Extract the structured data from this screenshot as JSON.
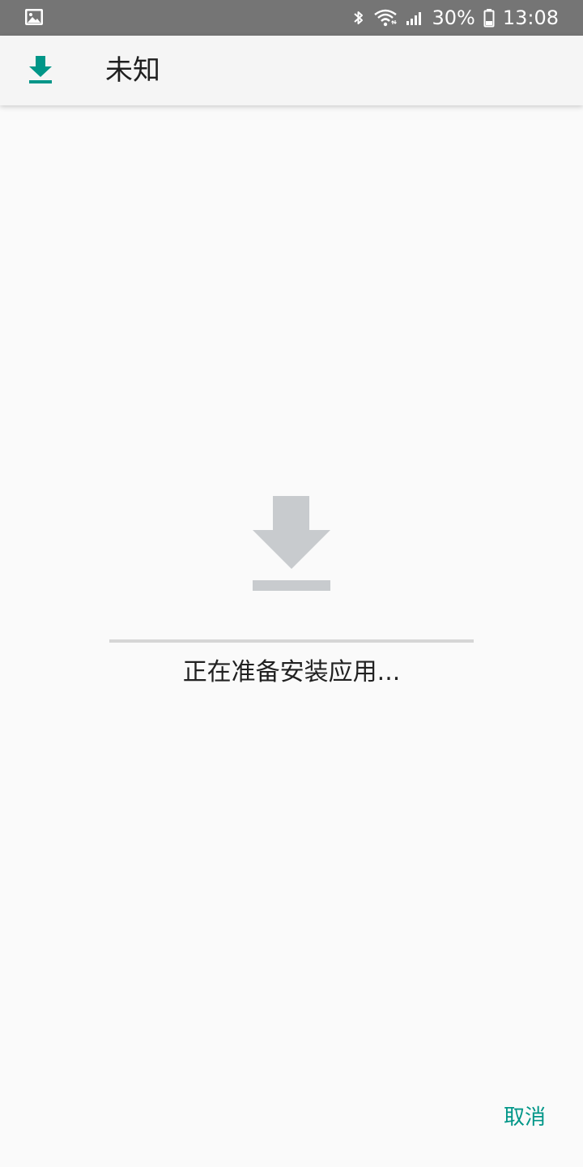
{
  "status_bar": {
    "left_icon": "image-notification-icon",
    "battery_percent": "30%",
    "time": "13:08",
    "icons": [
      "bluetooth-icon",
      "wifi-icon",
      "signal-icon",
      "battery-icon"
    ]
  },
  "app_bar": {
    "icon": "download-icon",
    "title": "未知"
  },
  "installer": {
    "icon": "download-arrow-icon",
    "status": "正在准备安装应用...",
    "progress": 0
  },
  "actions": {
    "cancel_label": "取消"
  },
  "colors": {
    "accent": "#009688",
    "status_bar_bg": "#757575",
    "app_bar_bg": "#f5f5f5",
    "background": "#fafafa",
    "icon_gray": "#c8cbce",
    "track_gray": "#d6d6d6"
  }
}
